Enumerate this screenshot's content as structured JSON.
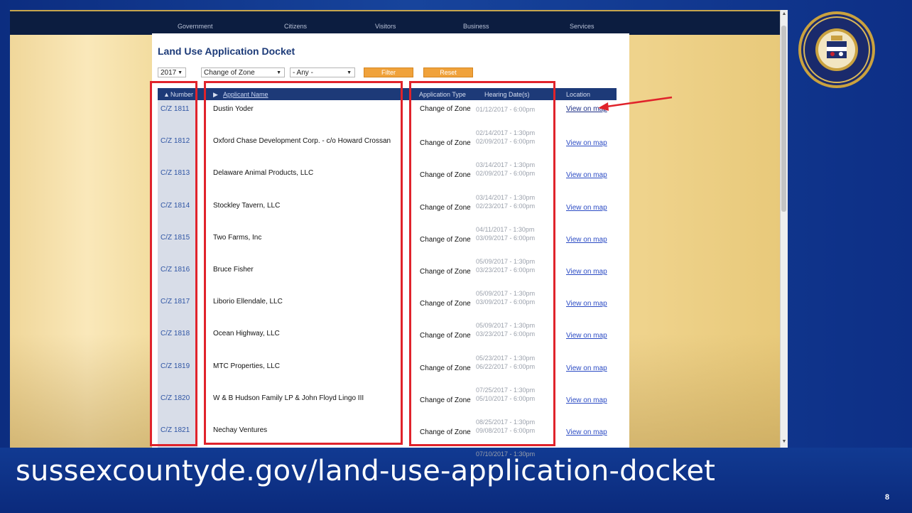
{
  "nav": {
    "items": [
      "Government",
      "Citizens",
      "Visitors",
      "Business",
      "Services"
    ]
  },
  "page": {
    "title": "Land Use Application Docket"
  },
  "filters": {
    "year": "2017",
    "type": "Change of Zone",
    "status": "- Any -",
    "filter_label": "Filter",
    "reset_label": "Reset"
  },
  "table": {
    "headers": {
      "number": "Number",
      "applicant": "Applicant Name",
      "type": "Application Type",
      "dates": "Hearing Date(s)",
      "location": "Location"
    },
    "rows": [
      {
        "number": "C/Z 1811",
        "applicant": "Dustin Yoder",
        "type": "Change of Zone",
        "dates": [
          "",
          "01/12/2017 - 6:00pm"
        ],
        "location": "View on map"
      },
      {
        "number": "C/Z 1812",
        "applicant": "Oxford Chase Development Corp. - c/o Howard Crossan",
        "type": "Change of Zone",
        "dates": [
          "02/14/2017 - 1:30pm",
          "02/09/2017 - 6:00pm"
        ],
        "location": "View on map"
      },
      {
        "number": "C/Z 1813",
        "applicant": "Delaware Animal Products, LLC",
        "type": "Change of Zone",
        "dates": [
          "03/14/2017 - 1:30pm",
          "02/09/2017 - 6:00pm"
        ],
        "location": "View on map"
      },
      {
        "number": "C/Z 1814",
        "applicant": "Stockley Tavern, LLC",
        "type": "Change of Zone",
        "dates": [
          "03/14/2017 - 1:30pm",
          "02/23/2017 - 6:00pm"
        ],
        "location": "View on map"
      },
      {
        "number": "C/Z 1815",
        "applicant": "Two Farms, Inc",
        "type": "Change of Zone",
        "dates": [
          "04/11/2017 - 1:30pm",
          "03/09/2017 - 6:00pm"
        ],
        "location": "View on map"
      },
      {
        "number": "C/Z 1816",
        "applicant": "Bruce Fisher",
        "type": "Change of Zone",
        "dates": [
          "05/09/2017 - 1:30pm",
          "03/23/2017 - 6:00pm"
        ],
        "location": "View on map"
      },
      {
        "number": "C/Z 1817",
        "applicant": "Liborio Ellendale, LLC",
        "type": "Change of Zone",
        "dates": [
          "05/09/2017 - 1:30pm",
          "03/09/2017 - 6:00pm"
        ],
        "location": "View on map"
      },
      {
        "number": "C/Z 1818",
        "applicant": "Ocean Highway, LLC",
        "type": "Change of Zone",
        "dates": [
          "05/09/2017 - 1:30pm",
          "03/23/2017 - 6:00pm"
        ],
        "location": "View on map"
      },
      {
        "number": "C/Z 1819",
        "applicant": "MTC Properties, LLC",
        "type": "Change of Zone",
        "dates": [
          "05/23/2017 - 1:30pm",
          "06/22/2017 - 6:00pm"
        ],
        "location": "View on map"
      },
      {
        "number": "C/Z 1820",
        "applicant": "W & B Hudson Family LP & John Floyd Lingo III",
        "type": "Change of Zone",
        "dates": [
          "07/25/2017 - 1:30pm",
          "05/10/2017 - 6:00pm"
        ],
        "location": "View on map"
      },
      {
        "number": "C/Z 1821",
        "applicant": "Nechay Ventures",
        "type": "Change of Zone",
        "dates": [
          "08/25/2017 - 1:30pm",
          "09/08/2017 - 6:00pm"
        ],
        "location": "View on map"
      }
    ],
    "trailing_date": "07/10/2017 - 1:30pm"
  },
  "caption": {
    "url": "sussexcountyde.gov/land-use-application-docket",
    "slide_number": "8"
  },
  "colors": {
    "highlight": "#e0232b",
    "header": "#1d3a78",
    "button": "#f0a23b",
    "slide_blue": "#0d2f86"
  }
}
